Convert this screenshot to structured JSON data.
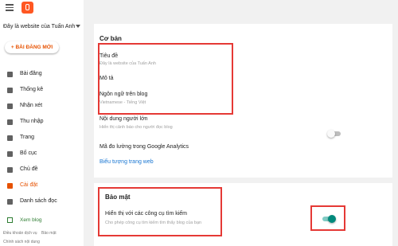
{
  "sidebar": {
    "blog_title": "Đây là website của Tuấn Anh",
    "new_post_label": "+ BÀI ĐĂNG MỚI",
    "items": [
      {
        "label": "Bài đăng",
        "icon": "posts-icon"
      },
      {
        "label": "Thống kê",
        "icon": "stats-icon"
      },
      {
        "label": "Nhận xét",
        "icon": "comments-icon"
      },
      {
        "label": "Thu nhập",
        "icon": "earnings-icon"
      },
      {
        "label": "Trang",
        "icon": "pages-icon"
      },
      {
        "label": "Bố cục",
        "icon": "layout-icon"
      },
      {
        "label": "Chủ đề",
        "icon": "theme-icon"
      },
      {
        "label": "Cài đặt",
        "icon": "settings-icon",
        "active": true
      },
      {
        "label": "Danh sách đọc",
        "icon": "reading-list-icon"
      }
    ],
    "view_blog_label": "Xem blog",
    "footer_links": [
      "Điều khoản dịch vụ",
      "Bảo mật",
      "Chính sách nội dung"
    ]
  },
  "colors": {
    "accent": "#e65100",
    "highlight": "#e53935",
    "toggle_on": "#00897b",
    "link": "#1976d2"
  },
  "basic": {
    "title": "Cơ bản",
    "blog_title_label": "Tiêu đề",
    "blog_title_value": "Đây là website của Tuấn Anh",
    "description_label": "Mô tả",
    "language_label": "Ngôn ngữ trên blog",
    "language_value": "Vietnamese - Tiếng Việt",
    "adult_label": "Nội dung người lớn",
    "adult_sub": "Hiển thị cảnh báo cho người đọc blog",
    "adult_toggle": "off",
    "analytics_label": "Mã đo lường trong Google Analytics",
    "favicon_label": "Biểu tượng trang web"
  },
  "privacy": {
    "title": "Bảo mật",
    "search_label": "Hiển thị với các công cụ tìm kiếm",
    "search_sub": "Cho phép công cụ tìm kiếm tìm thấy blog của bạn",
    "search_toggle": "on"
  }
}
